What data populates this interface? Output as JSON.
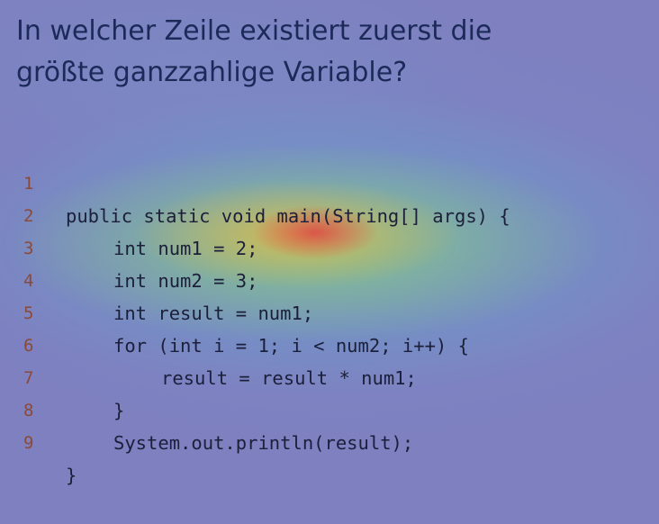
{
  "question": {
    "line1": "In welcher Zeile existiert zuerst die",
    "line2": "größte ganzzahlige Variable?"
  },
  "code": {
    "lines": [
      {
        "number": "1",
        "text": "public static void main(String[] args) {"
      },
      {
        "number": "2",
        "text": "int num1 = 2;"
      },
      {
        "number": "3",
        "text": "int num2 = 3;"
      },
      {
        "number": "4",
        "text": "int result = num1;"
      },
      {
        "number": "5",
        "text": "for (int i = 1; i < num2; i++) {"
      },
      {
        "number": "6",
        "text": "result = result * num1;"
      },
      {
        "number": "7",
        "text": "}"
      },
      {
        "number": "8",
        "text": "System.out.println(result);"
      },
      {
        "number": "9",
        "text": "}"
      }
    ]
  },
  "colors": {
    "background": "#7e80c0",
    "heat_high": "#dc4646",
    "heat_mid": "#ebb446",
    "heat_low": "#96d26e",
    "text": "#1b1f3a",
    "line_number": "#8a4a3a"
  }
}
